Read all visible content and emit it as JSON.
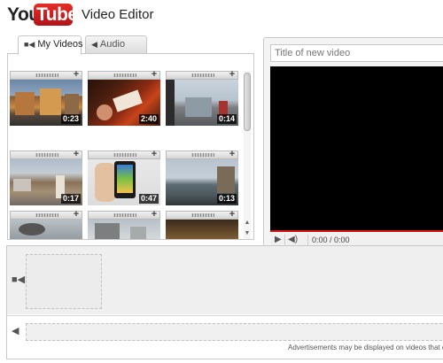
{
  "header": {
    "logo": {
      "you": "You",
      "tube": "Tube"
    },
    "title": "Video Editor"
  },
  "tabs": [
    {
      "label": "My Videos",
      "icon": "video-camera-icon",
      "active": true
    },
    {
      "label": "Audio",
      "icon": "speaker-icon",
      "active": false
    }
  ],
  "clips": [
    {
      "duration": "0:23"
    },
    {
      "duration": "2:40"
    },
    {
      "duration": "0:14"
    },
    {
      "duration": "0:17"
    },
    {
      "duration": "0:47"
    },
    {
      "duration": "0:13"
    },
    {
      "duration": ""
    },
    {
      "duration": ""
    },
    {
      "duration": ""
    }
  ],
  "player": {
    "title_placeholder": "Title of new video",
    "time": "0:00 / 0:00"
  },
  "timeline": {
    "ad_note": "Advertisements may be displayed on videos that conta"
  },
  "colors": {
    "brand_red": "#cc181e",
    "progress_red": "#dd1111",
    "panel_border": "#c8c8c8"
  }
}
